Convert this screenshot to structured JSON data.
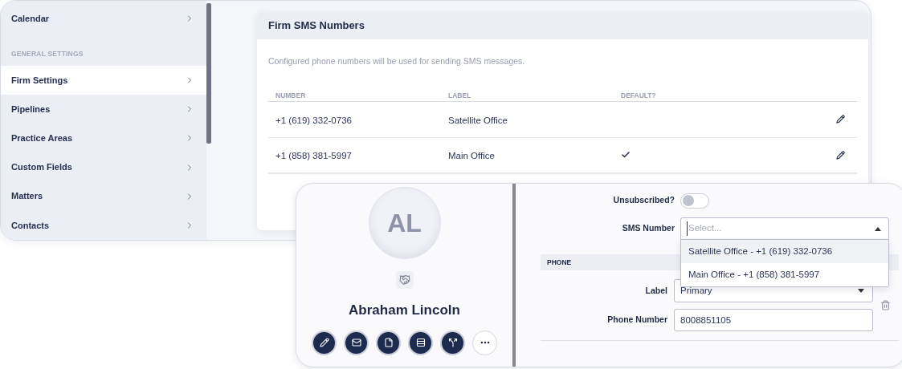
{
  "sidebar": {
    "items": [
      {
        "kind": "link",
        "label": "Calendar",
        "selected": false
      },
      {
        "kind": "heading",
        "label": "GENERAL SETTINGS"
      },
      {
        "kind": "link",
        "label": "Firm Settings",
        "selected": true
      },
      {
        "kind": "link",
        "label": "Pipelines",
        "selected": false
      },
      {
        "kind": "link",
        "label": "Practice Areas",
        "selected": false
      },
      {
        "kind": "link",
        "label": "Custom Fields",
        "selected": false
      },
      {
        "kind": "link",
        "label": "Matters",
        "selected": false
      },
      {
        "kind": "link",
        "label": "Contacts",
        "selected": false
      }
    ]
  },
  "sms_numbers": {
    "title": "Firm SMS Numbers",
    "description": "Configured phone numbers will be used for sending SMS messages.",
    "table": {
      "columns": [
        "NUMBER",
        "LABEL",
        "DEFAULT?"
      ],
      "rows": [
        {
          "number": "+1 (619) 332-0736",
          "label": "Satellite Office",
          "default": false
        },
        {
          "number": "+1 (858) 381-5997",
          "label": "Main Office",
          "default": true
        }
      ]
    }
  },
  "contact": {
    "initials": "AL",
    "name": "Abraham Lincoln",
    "actions": [
      {
        "kind": "edit"
      },
      {
        "kind": "email"
      },
      {
        "kind": "document"
      },
      {
        "kind": "list"
      },
      {
        "kind": "route"
      },
      {
        "kind": "more"
      }
    ]
  },
  "form": {
    "unsubscribed": {
      "label": "Unsubscribed?",
      "on": false
    },
    "sms_number": {
      "label": "SMS Number",
      "placeholder": "Select...",
      "expanded": true,
      "options": [
        {
          "label": "Satellite Office - +1 (619) 332-0736",
          "selected": true
        },
        {
          "label": "Main Office - +1 (858) 381-5997",
          "selected": false
        }
      ]
    },
    "phone": {
      "heading": "PHONE",
      "label": {
        "label": "Label",
        "value": "Primary"
      },
      "number": {
        "label": "Phone Number",
        "value": "8008851105"
      }
    }
  }
}
